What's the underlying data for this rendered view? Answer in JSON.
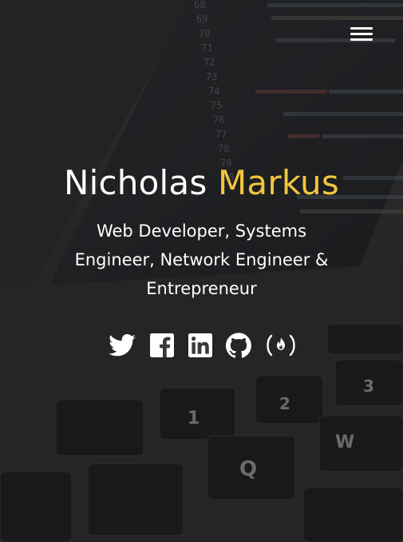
{
  "hero": {
    "first_name": "Nicholas",
    "last_name": "Markus",
    "tagline": "Web Developer, Systems Engineer, Network Engineer & Entrepreneur",
    "accent_color": "#f2c53d"
  },
  "nav": {
    "menu_icon": "hamburger-menu-icon"
  },
  "socials": [
    {
      "name": "twitter",
      "icon": "twitter-icon"
    },
    {
      "name": "facebook",
      "icon": "facebook-icon"
    },
    {
      "name": "linkedin",
      "icon": "linkedin-icon"
    },
    {
      "name": "github",
      "icon": "github-icon"
    },
    {
      "name": "freecodecamp",
      "icon": "freecodecamp-icon"
    }
  ]
}
